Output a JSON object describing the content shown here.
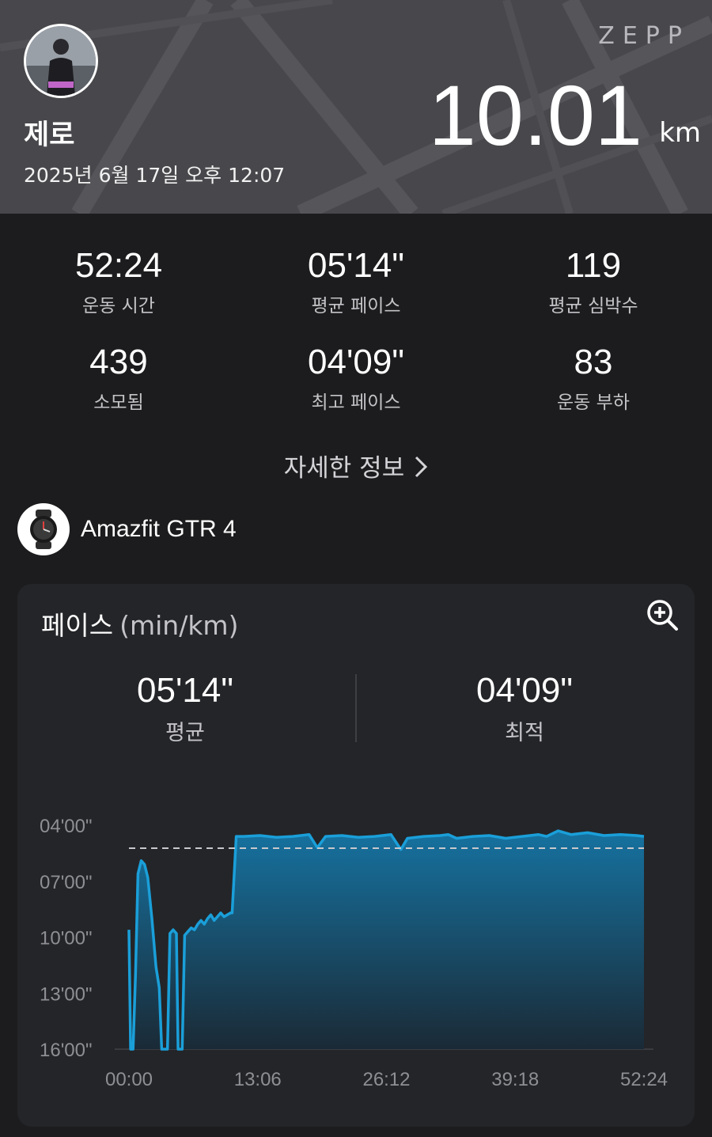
{
  "header": {
    "brand": "ZEPP",
    "user_name": "제로",
    "timestamp": "2025년 6월 17일 오후 12:07",
    "distance": "10.01",
    "distance_unit": "km"
  },
  "stats": [
    {
      "value": "52:24",
      "label": "운동 시간"
    },
    {
      "value": "05'14\"",
      "label": "평균 페이스"
    },
    {
      "value": "119",
      "label": "평균 심박수"
    },
    {
      "value": "439",
      "label": "소모됨"
    },
    {
      "value": "04'09\"",
      "label": "최고 페이스"
    },
    {
      "value": "83",
      "label": "운동 부하"
    }
  ],
  "details_link": "자세한 정보",
  "device": {
    "name": "Amazfit GTR 4",
    "icon": "watch-icon"
  },
  "pace_card": {
    "title": "페이스",
    "unit": "(min/km)",
    "average_value": "05'14\"",
    "average_label": "평균",
    "best_value": "04'09\"",
    "best_label": "최적",
    "zoom_icon": "zoom-in-icon"
  },
  "colors": {
    "accent": "#1a9fd9",
    "background": "#1c1c1e",
    "card": "#242528",
    "header": "#4a4a4e"
  },
  "chart_data": {
    "type": "area",
    "x_label_unit": "elapsed time",
    "x_ticks": [
      "00:00",
      "13:06",
      "26:12",
      "39:18",
      "52:24"
    ],
    "y_ticks": [
      "04'00\"",
      "07'00\"",
      "10'00\"",
      "13'00\"",
      "16'00\""
    ],
    "y_inverted": true,
    "y_range_min_per_km": [
      4,
      16
    ],
    "x_range_seconds": [
      0,
      3144
    ],
    "average_line_min_per_km": 5.23,
    "points": [
      [
        0,
        9.6
      ],
      [
        10,
        16
      ],
      [
        25,
        16
      ],
      [
        40,
        12
      ],
      [
        55,
        6.6
      ],
      [
        75,
        5.9
      ],
      [
        95,
        6.1
      ],
      [
        115,
        6.8
      ],
      [
        140,
        9
      ],
      [
        165,
        11.6
      ],
      [
        185,
        12.7
      ],
      [
        200,
        16
      ],
      [
        235,
        16
      ],
      [
        250,
        9.8
      ],
      [
        270,
        9.6
      ],
      [
        290,
        9.8
      ],
      [
        300,
        16
      ],
      [
        325,
        16
      ],
      [
        340,
        9.9
      ],
      [
        360,
        9.7
      ],
      [
        380,
        9.5
      ],
      [
        400,
        9.6
      ],
      [
        420,
        9.3
      ],
      [
        440,
        9.1
      ],
      [
        460,
        9.3
      ],
      [
        480,
        9.0
      ],
      [
        500,
        8.8
      ],
      [
        520,
        9.1
      ],
      [
        540,
        8.9
      ],
      [
        560,
        8.7
      ],
      [
        580,
        8.9
      ],
      [
        600,
        8.8
      ],
      [
        620,
        8.7
      ],
      [
        630,
        8.7
      ],
      [
        655,
        4.6
      ],
      [
        700,
        4.6
      ],
      [
        800,
        4.55
      ],
      [
        900,
        4.65
      ],
      [
        1000,
        4.6
      ],
      [
        1100,
        4.5
      ],
      [
        1150,
        5.2
      ],
      [
        1200,
        4.6
      ],
      [
        1300,
        4.55
      ],
      [
        1400,
        4.65
      ],
      [
        1500,
        4.6
      ],
      [
        1600,
        4.5
      ],
      [
        1660,
        5.3
      ],
      [
        1700,
        4.7
      ],
      [
        1800,
        4.6
      ],
      [
        1900,
        4.55
      ],
      [
        1950,
        4.5
      ],
      [
        2000,
        4.7
      ],
      [
        2100,
        4.6
      ],
      [
        2200,
        4.55
      ],
      [
        2300,
        4.7
      ],
      [
        2400,
        4.6
      ],
      [
        2500,
        4.5
      ],
      [
        2550,
        4.6
      ],
      [
        2620,
        4.3
      ],
      [
        2700,
        4.5
      ],
      [
        2800,
        4.4
      ],
      [
        2900,
        4.55
      ],
      [
        3000,
        4.5
      ],
      [
        3100,
        4.55
      ],
      [
        3144,
        4.6
      ]
    ]
  }
}
